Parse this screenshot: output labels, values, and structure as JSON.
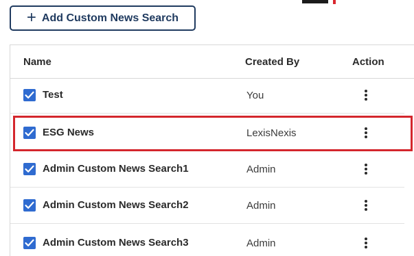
{
  "top_corner_text": "",
  "toolbar": {
    "add_button_label": "Add Custom News Search"
  },
  "table": {
    "headers": {
      "name": "Name",
      "created_by": "Created By",
      "action": "Action"
    },
    "rows": [
      {
        "name": "Test",
        "created_by": "You",
        "checked": true,
        "highlighted": false
      },
      {
        "name": "ESG News",
        "created_by": "LexisNexis",
        "checked": true,
        "highlighted": true
      },
      {
        "name": "Admin Custom News Search1",
        "created_by": "Admin",
        "checked": true,
        "highlighted": false
      },
      {
        "name": "Admin Custom News Search2",
        "created_by": "Admin",
        "checked": true,
        "highlighted": false
      },
      {
        "name": "Admin Custom News Search3",
        "created_by": "Admin",
        "checked": true,
        "highlighted": false
      }
    ]
  },
  "colors": {
    "accent": "#1f3a5f",
    "checkbox": "#2f6bd0",
    "highlight": "#d4262c"
  }
}
